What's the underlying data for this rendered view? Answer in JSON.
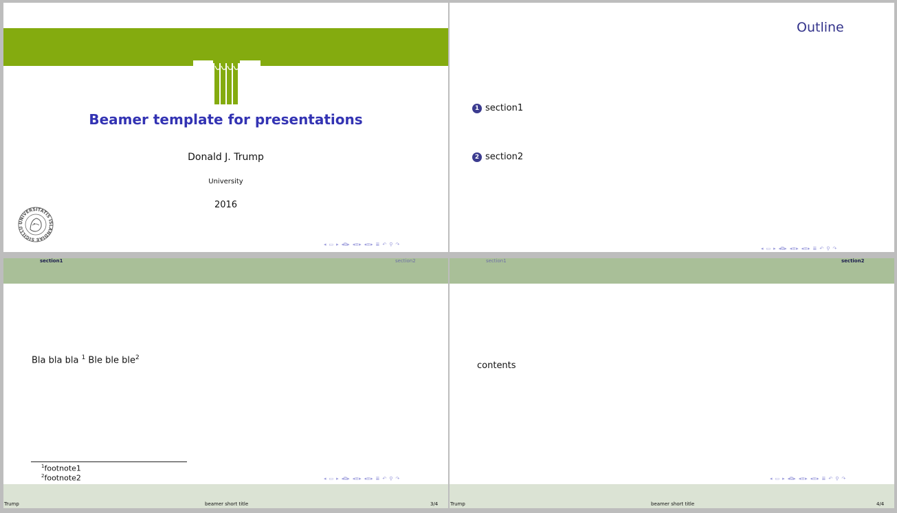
{
  "title_slide": {
    "title": "Beamer template for presentations",
    "author": "Donald J. Trump",
    "institute": "University",
    "date": "2016",
    "seal_text": "UNIVERSITATIS ISLANDIAE SIGILLUM",
    "logo_color": "#84ab0f",
    "title_color": "#3333b3"
  },
  "outline_slide": {
    "frametitle": "Outline",
    "toc": [
      {
        "number": "1",
        "label": "section1"
      },
      {
        "number": "2",
        "label": "section2"
      }
    ]
  },
  "footnote_slide": {
    "header_sections": [
      {
        "label": "section1",
        "active": true
      },
      {
        "label": "section2",
        "active": false
      }
    ],
    "body_start": "Bla bla bla ",
    "mark1": "1",
    "body_mid": " Ble ble ble",
    "mark2": "2",
    "footnotes": [
      {
        "mark": "1",
        "text": "footnote1"
      },
      {
        "mark": "2",
        "text": "footnote2"
      }
    ],
    "footer": {
      "author": "Trump",
      "short_title": "beamer short title",
      "page": "3/4"
    }
  },
  "contents_slide": {
    "header_sections": [
      {
        "label": "section1",
        "active": false
      },
      {
        "label": "section2",
        "active": true
      }
    ],
    "body": "contents",
    "footer": {
      "author": "Trump",
      "short_title": "beamer short title",
      "page": "4/4"
    }
  },
  "nav_icons": [
    "arrow-left-icon",
    "slide-icon",
    "arrow-right-icon",
    "frame-icon",
    "subsection-icon",
    "section-icon",
    "doc-icon",
    "back-icon",
    "search-icon",
    "forward-icon"
  ],
  "colors": {
    "header": "#a9bf98",
    "footer": "#dbe3d4",
    "toc_ball": "#3b3b8f",
    "frametitle": "#33338b"
  }
}
